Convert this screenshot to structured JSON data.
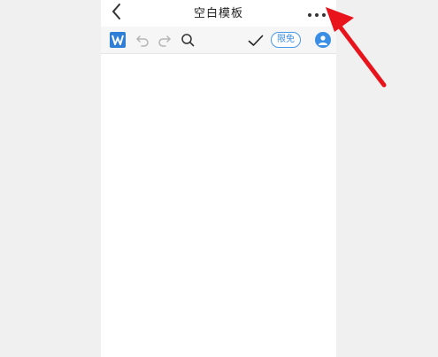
{
  "header": {
    "title": "空白模板"
  },
  "toolbar": {
    "limited_label": "限免"
  },
  "icons": {
    "back": "chevron-left-icon",
    "more": "more-dots-icon",
    "app_logo": "wps-w-logo",
    "undo": "undo-icon",
    "redo": "redo-icon",
    "search": "search-icon",
    "confirm": "checkmark-icon",
    "account": "user-avatar-icon",
    "annotation": "red-arrow"
  },
  "colors": {
    "accent": "#2f7ed8",
    "annotation_arrow": "#e8131b",
    "disabled_icon": "#b5b5b5"
  }
}
